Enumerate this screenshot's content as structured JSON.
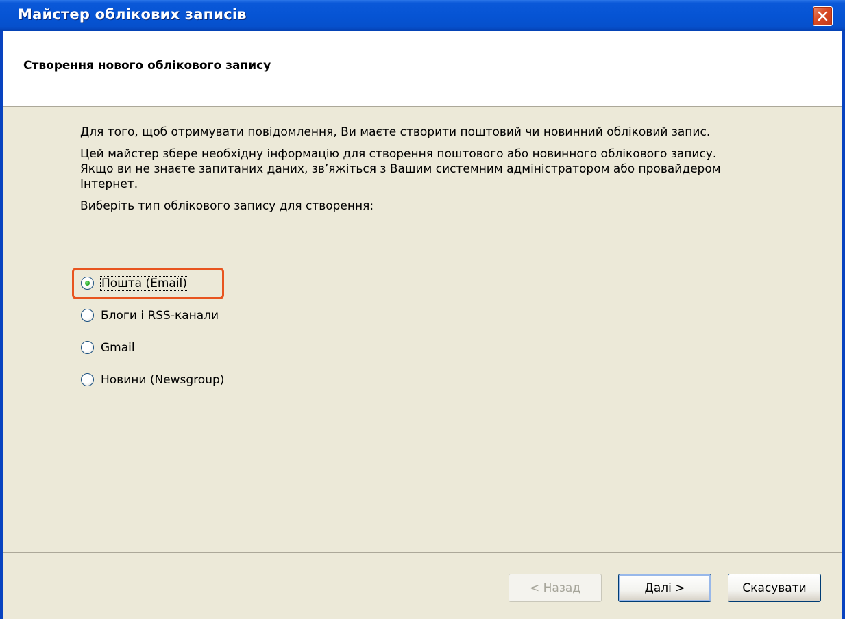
{
  "window": {
    "title": "Майстер облікових записів"
  },
  "header": {
    "title": "Створення нового облікового запису"
  },
  "content": {
    "paragraph1": "Для того, щоб отримувати повідомлення, Ви маєте створити поштовий чи новинний обліковий запис.",
    "paragraph2": "Цей майстер збере необхідну інформацію для створення поштового або новинного облікового запису. Якщо ви не знаєте запитаних даних, зв’яжіться з Вашим системним адміністратором або провайдером Інтернет.",
    "prompt": "Виберіть тип облікового запису для створення:"
  },
  "account_types": [
    {
      "label": "Пошта (Email)",
      "checked": true
    },
    {
      "label": "Блоги і RSS-канали",
      "checked": false
    },
    {
      "label": "Gmail",
      "checked": false
    },
    {
      "label": "Новини (Newsgroup)",
      "checked": false
    }
  ],
  "buttons": {
    "back_label": "< Назад",
    "next_label": "Далі >",
    "cancel_label": "Скасувати"
  },
  "colors": {
    "titlebar": "#0654d4",
    "highlight": "#e8551f",
    "dialog_bg": "#ece9d8"
  }
}
